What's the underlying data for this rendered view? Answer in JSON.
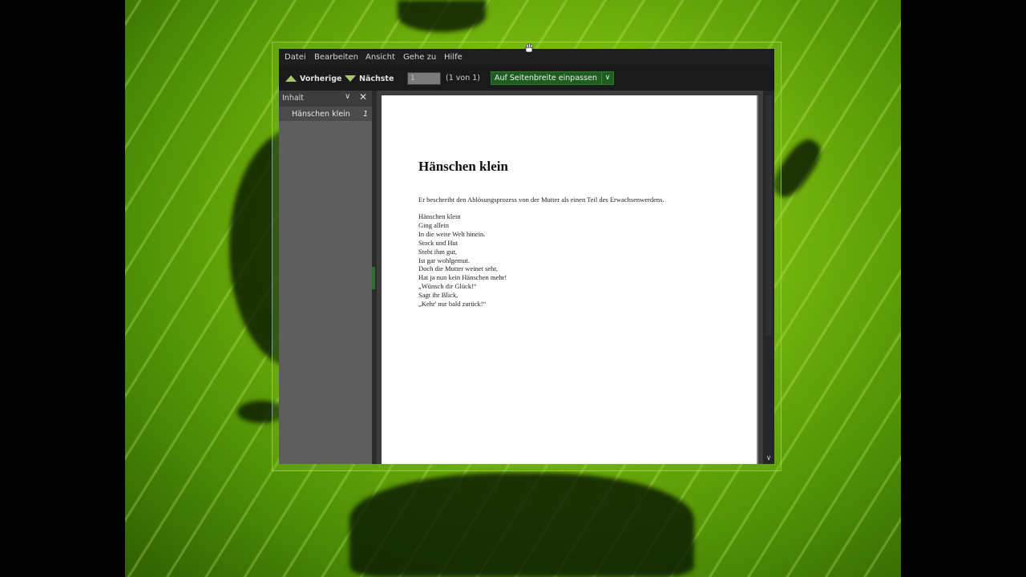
{
  "menubar": {
    "items": [
      {
        "label": "Datei"
      },
      {
        "label": "Bearbeiten"
      },
      {
        "label": "Ansicht"
      },
      {
        "label": "Gehe zu"
      },
      {
        "label": "Hilfe"
      }
    ]
  },
  "toolbar": {
    "prev_label": "Vorherige",
    "next_label": "Nächste",
    "page_value": "1",
    "page_count": "(1 von 1)",
    "zoom_value": "Auf Seitenbreite einpassen"
  },
  "sidebar": {
    "title": "Inhalt",
    "items": [
      {
        "label": "Hänschen klein",
        "page": "1"
      }
    ]
  },
  "document": {
    "title": "Hänschen klein",
    "intro": "Er beschreibt den Ablösungsprozess von der Mutter als einen Teil des Erwachsenwerdens.",
    "lines": [
      "Hänschen klein",
      "Ging allein",
      "In die weite Welt hinein.",
      "Stock und Hut",
      "Steht ihm gut,",
      "Ist gar wohlgemut.",
      "Doch die Mutter weinet sehr,",
      "Hat ja nun kein Hänschen mehr!",
      "„Wünsch dir Glück!“",
      "Sagt ihr Blick,",
      "„Kehr' nur bald zurück!“"
    ]
  },
  "icons": {
    "prev": "arrow-up-icon",
    "next": "arrow-down-icon",
    "dropdown": "chevron-down-icon",
    "close": "close-icon"
  },
  "colors": {
    "accent": "#1f5c1f",
    "wallpaper": "#78b80d"
  }
}
